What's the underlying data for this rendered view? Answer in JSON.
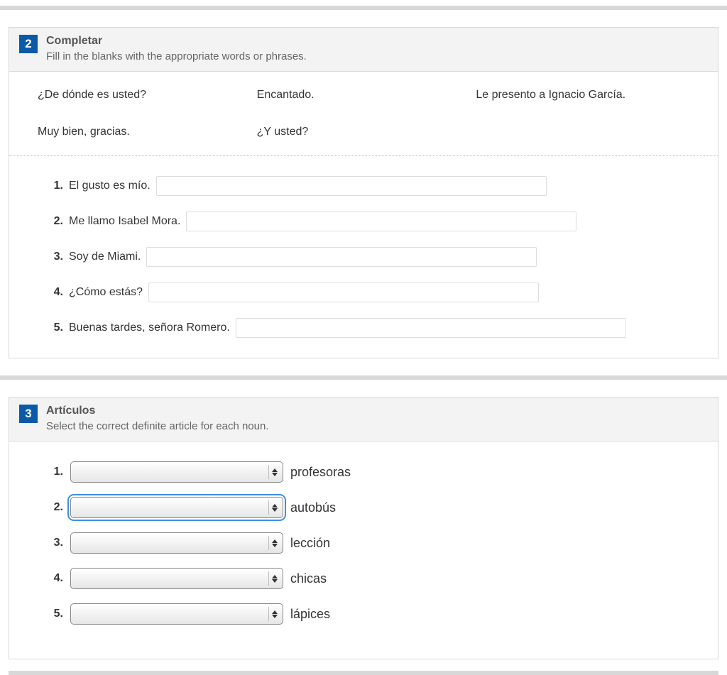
{
  "sections": {
    "s2": {
      "number": "2",
      "title": "Completar",
      "desc": "Fill in the blanks with the appropriate words or phrases.",
      "wordbank": [
        "¿De dónde es usted?",
        "Encantado.",
        "Le presento a Ignacio García.",
        "Muy bien, gracias.",
        "¿Y usted?"
      ],
      "items": [
        {
          "num": "1.",
          "prompt": "El gusto es mío."
        },
        {
          "num": "2.",
          "prompt": "Me llamo Isabel Mora."
        },
        {
          "num": "3.",
          "prompt": "Soy de Miami."
        },
        {
          "num": "4.",
          "prompt": "¿Cómo estás?"
        },
        {
          "num": "5.",
          "prompt": "Buenas tardes, señora Romero."
        }
      ]
    },
    "s3": {
      "number": "3",
      "title": "Artículos",
      "desc": "Select the correct definite article for each noun.",
      "items": [
        {
          "num": "1.",
          "noun": "profesoras"
        },
        {
          "num": "2.",
          "noun": "autobús"
        },
        {
          "num": "3.",
          "noun": "lección"
        },
        {
          "num": "4.",
          "noun": "chicas"
        },
        {
          "num": "5.",
          "noun": "lápices"
        }
      ]
    }
  }
}
